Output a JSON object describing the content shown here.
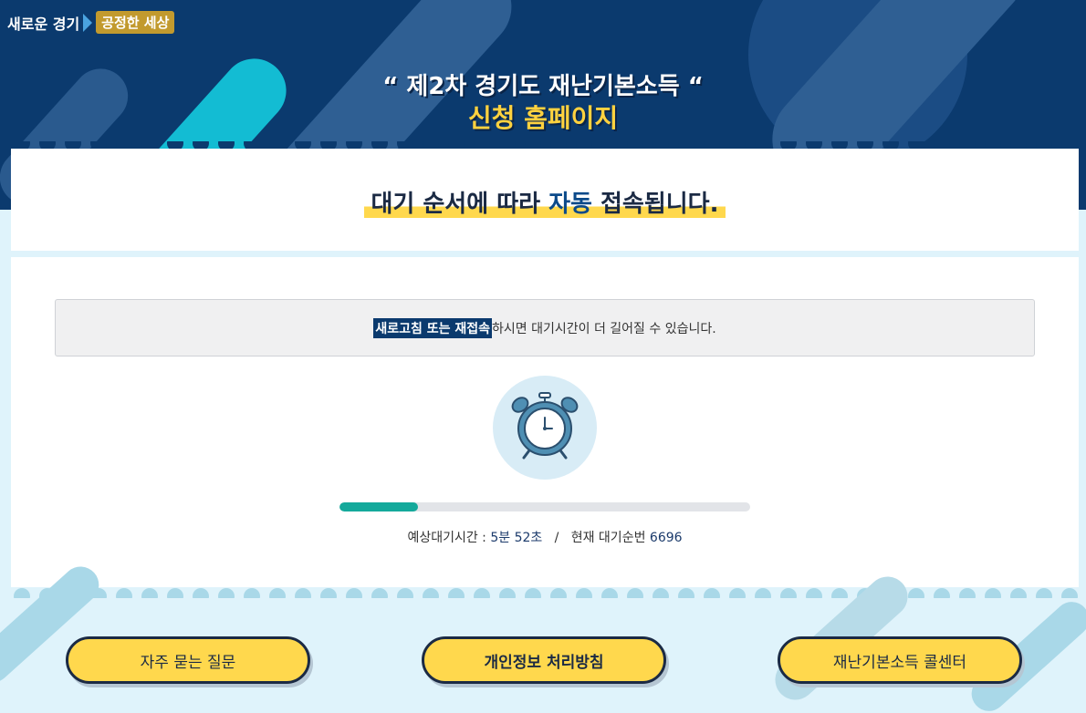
{
  "header": {
    "logo_part1": "새로운 경기",
    "logo_part2": "공정한 세상",
    "title_line1": "“ 제2차 경기도 재난기본소득 “",
    "title_line2": "신청 홈페이지"
  },
  "banner": {
    "heading_before": "대기 순서에 따라 ",
    "heading_highlight": "자동",
    "heading_after": " 접속됩니다."
  },
  "notice": {
    "highlight": "새로고침 또는 재접속",
    "text": " 하시면 대기시간이 더 길어질 수 있습니다."
  },
  "queue": {
    "progress_percent": 19,
    "wait_label": "예상대기시간 : ",
    "wait_time": "5분 52초",
    "separator": "   /   ",
    "order_label": "현재 대기순번 ",
    "order_number": "6696"
  },
  "buttons": {
    "faq": "자주 묻는 질문",
    "privacy": "개인정보 처리방침",
    "callcenter": "재난기본소득 콜센터"
  },
  "colors": {
    "header_bg": "#0b3a6e",
    "accent_yellow": "#ffd84d",
    "progress": "#14a99b"
  }
}
